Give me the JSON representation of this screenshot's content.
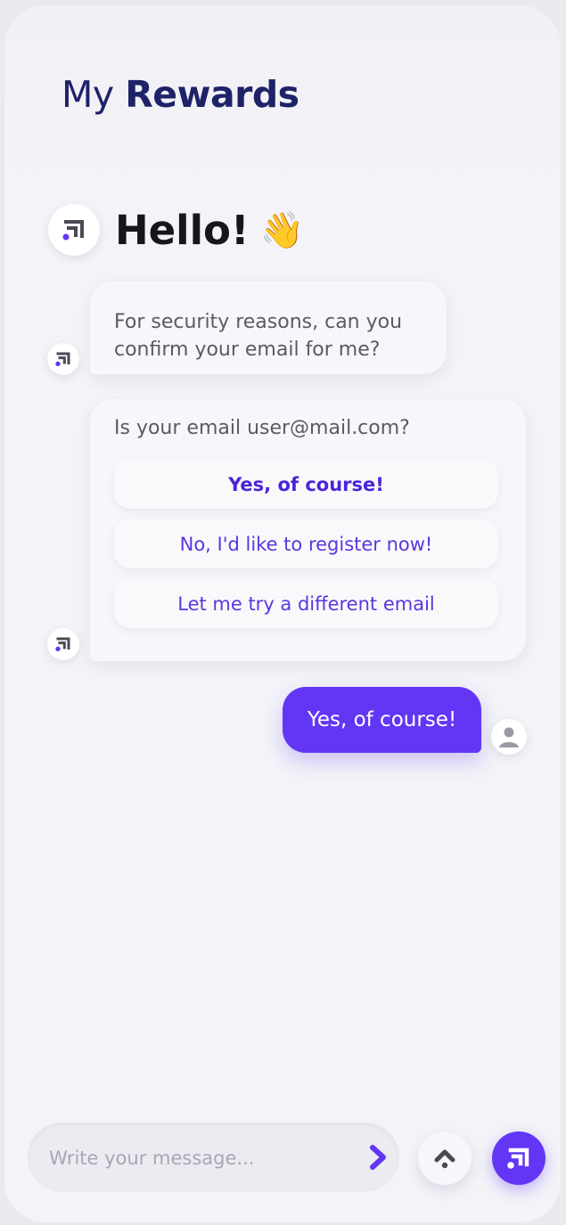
{
  "header": {
    "title_light": "My",
    "title_bold": "Rewards"
  },
  "greeting": {
    "text": "Hello!",
    "emoji": "👋"
  },
  "messages": {
    "security": "For security reasons, can you confirm your email for me?",
    "email_question": "Is your email user@mail.com?",
    "options": [
      {
        "label": "Yes, of course!",
        "selected": true
      },
      {
        "label": "No, I'd like to register now!",
        "selected": false
      },
      {
        "label": "Let me try a different email",
        "selected": false
      }
    ],
    "user_reply": "Yes, of course!"
  },
  "composer": {
    "placeholder": "Write your message..."
  },
  "colors": {
    "accent": "#6236f4",
    "title": "#1e2268",
    "background": "#f3f3f8",
    "logo_gray": "#4a4a55"
  },
  "icons": [
    "bot-logo-icon",
    "wave-emoji-icon",
    "user-avatar-icon",
    "send-chevron-icon",
    "scroll-up-icon",
    "brand-logo-icon"
  ]
}
